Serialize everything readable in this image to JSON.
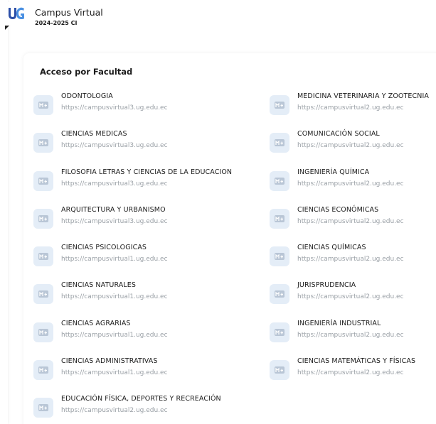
{
  "brand": {
    "title": "Campus Virtual",
    "period": "2024-2025 CI",
    "logo_text": "UG",
    "accent_color": "#2c4fa8"
  },
  "section": {
    "title": "Acceso por Facultad"
  },
  "item_icon": "moodle-icon",
  "faculties_left": [
    {
      "name": "ODONTOLOGIA",
      "url": "https://campusvirtual3.ug.edu.ec"
    },
    {
      "name": "CIENCIAS MEDICAS",
      "url": "https://campusvirtual3.ug.edu.ec"
    },
    {
      "name": "FILOSOFIA LETRAS Y CIENCIAS DE LA EDUCACION",
      "url": "https://campusvirtual3.ug.edu.ec"
    },
    {
      "name": "ARQUITECTURA Y URBANISMO",
      "url": "https://campusvirtual3.ug.edu.ec"
    },
    {
      "name": "CIENCIAS PSICOLOGICAS",
      "url": "https://campusvirtual1.ug.edu.ec"
    },
    {
      "name": "CIENCIAS NATURALES",
      "url": "https://campusvirtual1.ug.edu.ec"
    },
    {
      "name": "CIENCIAS AGRARIAS",
      "url": "https://campusvirtual1.ug.edu.ec"
    },
    {
      "name": "CIENCIAS ADMINISTRATIVAS",
      "url": "https://campusvirtual1.ug.edu.ec"
    },
    {
      "name": "EDUCACIÓN FÍSICA, DEPORTES Y RECREACIÓN",
      "url": "https://campusvirtual2.ug.edu.ec"
    }
  ],
  "faculties_right": [
    {
      "name": "MEDICINA VETERINARIA Y ZOOTECNIA",
      "url": "https://campusvirtual2.ug.edu.ec"
    },
    {
      "name": "COMUNICACIÓN SOCIAL",
      "url": "https://campusvirtual2.ug.edu.ec"
    },
    {
      "name": "INGENIERÍA QUÍMICA",
      "url": "https://campusvirtual2.ug.edu.ec"
    },
    {
      "name": "CIENCIAS ECONÓMICAS",
      "url": "https://campusvirtual2.ug.edu.ec"
    },
    {
      "name": "CIENCIAS QUÍMICAS",
      "url": "https://campusvirtual2.ug.edu.ec"
    },
    {
      "name": "JURISPRUDENCIA",
      "url": "https://campusvirtual2.ug.edu.ec"
    },
    {
      "name": "INGENIERÍA INDUSTRIAL",
      "url": "https://campusvirtual2.ug.edu.ec"
    },
    {
      "name": "CIENCIAS MATEMÁTICAS Y FÍSICAS",
      "url": "https://campusvirtual2.ug.edu.ec"
    }
  ]
}
